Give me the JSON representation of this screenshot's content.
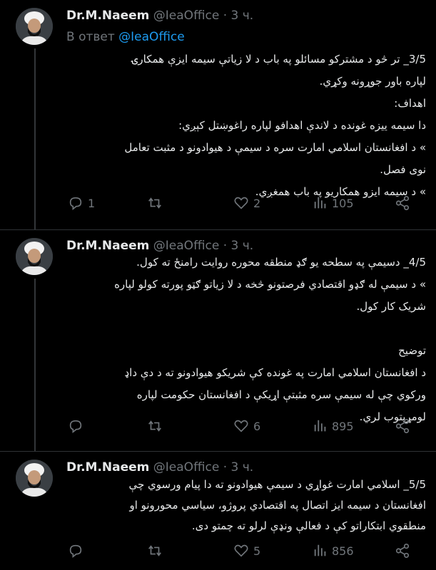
{
  "tweets": [
    {
      "author": "Dr.M.Naeem",
      "handle": "@IeaOffice",
      "separator": "·",
      "time": "3 ч.",
      "reply_prefix": "В ответ",
      "reply_to": "@IeaOffice",
      "text": "3/5_ تر څو د مشترکو مسائلو په باب د لا زياتې سیمه ایزې همکارۍ\nلپاره باور جوړونه وکړي.\nاهداف:\nدا سیمه ییزه غونده د لاندې اهدافو لپاره راغوښتل کېږي:\n» د افغانستان اسلامي امارت سره د سیمې د هیوادونو د مثبت تعامل\nنوی فصل.\n» د سیمه ایزو همکاریو په باب همغږي.",
      "replies": "1",
      "retweets": "",
      "likes": "2",
      "views": "105"
    },
    {
      "author": "Dr.M.Naeem",
      "handle": "@IeaOffice",
      "separator": "·",
      "time": "3 ч.",
      "text": "4/5_ دسیمې په سطحه یو ګډ منطقه محوره روایت رامنځ ته کول.\n» د سیمې له ګډو اقتصادي فرصتونو څخه د لا زیاتو ګټو پورته کولو لپاره\nشریک کار کول.\n\nتوضیح\nد افغانستان اسلامي امارت په غونده کې شریکو هیوادونو ته د دې داډ\nورکوي چې له سیمې سره مثبتې اړیکې د افغانستان حکومت لپاره\nلومړیتوب لري.",
      "replies": "",
      "retweets": "",
      "likes": "6",
      "views": "895"
    },
    {
      "author": "Dr.M.Naeem",
      "handle": "@IeaOffice",
      "separator": "·",
      "time": "3 ч.",
      "text": "5/5_ اسلامي امارت غواړي د سیمې هیوادونو ته دا پیام ورسوي چې\nافغانستان د سیمه ایز اتصال په اقتصادي پروژو، سیاسي محورونو او\nمنطقوي ابتکاراتو کې د فعالې ونډې لرلو ته چمتو دی.",
      "replies": "",
      "retweets": "",
      "likes": "5",
      "views": "856"
    }
  ],
  "icons": {
    "reply": "reply-icon",
    "retweet": "retweet-icon",
    "like": "heart-icon",
    "views": "views-icon",
    "share": "share-icon"
  },
  "colors": {
    "background": "#000000",
    "text": "#e7e9ea",
    "muted": "#71767b",
    "link": "#1d9bf0",
    "divider": "#2f3336"
  }
}
